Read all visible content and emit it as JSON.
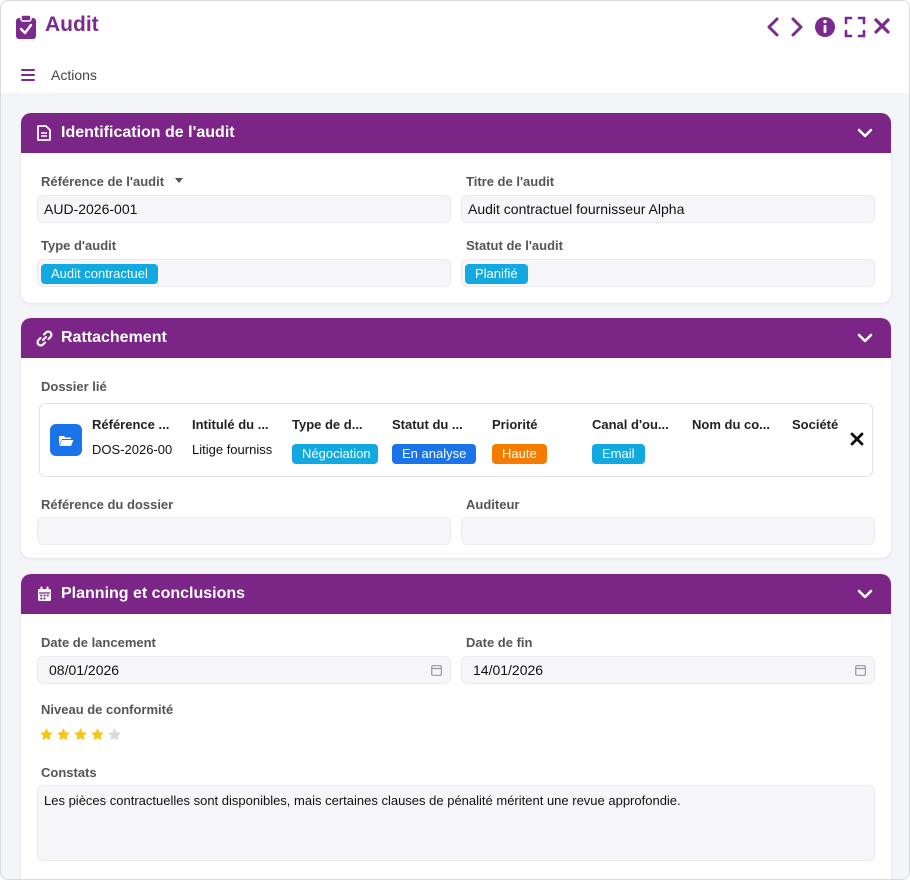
{
  "app": {
    "title": "Audit",
    "icon": "clipboard-check-icon",
    "accent_color": "#7b2687",
    "controls": [
      "prev-icon",
      "next-icon",
      "info-icon",
      "fullscreen-icon",
      "close-icon"
    ]
  },
  "actions": {
    "label": "Actions",
    "icon": "hamburger-menu-icon"
  },
  "identification": {
    "title": "Identification de l'audit",
    "icon": "document-icon",
    "reference": {
      "label": "Référence de l'audit",
      "value": "AUD-2026-001"
    },
    "titre": {
      "label": "Titre de l'audit",
      "value": "Audit contractuel fournisseur Alpha"
    },
    "type": {
      "label": "Type d'audit",
      "value": "Audit contractuel",
      "color": "#12a8e0"
    },
    "statut": {
      "label": "Statut de l'audit",
      "value": "Planifié",
      "color": "#12a8e0"
    }
  },
  "rattachement": {
    "title": "Rattachement",
    "icon": "link-icon",
    "dossier_label": "Dossier lié",
    "columns": [
      "Référence ...",
      "Intitulé du ...",
      "Type de d...",
      "Statut du ...",
      "Priorité",
      "Canal d'ou...",
      "Nom du co...",
      "Société"
    ],
    "row": {
      "reference": "DOS-2026-00",
      "intitule": "Litige fourniss",
      "type": "Négociation",
      "statut": "En analyse",
      "priorite": "Haute",
      "canal": "Email"
    },
    "tag_colors": {
      "type": "#12a8e0",
      "statut": "#1a73e8",
      "priorite": "#f57c00",
      "canal": "#12a8e0"
    },
    "reference_dossier": {
      "label": "Référence du dossier",
      "value": ""
    },
    "auditeur": {
      "label": "Auditeur",
      "value": ""
    }
  },
  "planning": {
    "title": "Planning et conclusions",
    "icon": "calendar-icon",
    "date_lancement": {
      "label": "Date de lancement",
      "value": "08/01/2026"
    },
    "date_fin": {
      "label": "Date de fin",
      "value": "14/01/2026"
    },
    "conformite": {
      "label": "Niveau de conformité",
      "rating": 4,
      "max": 5
    },
    "constats": {
      "label": "Constats",
      "value": "Les pièces contractuelles sont disponibles, mais certaines clauses de pénalité méritent une revue approfondie."
    }
  }
}
